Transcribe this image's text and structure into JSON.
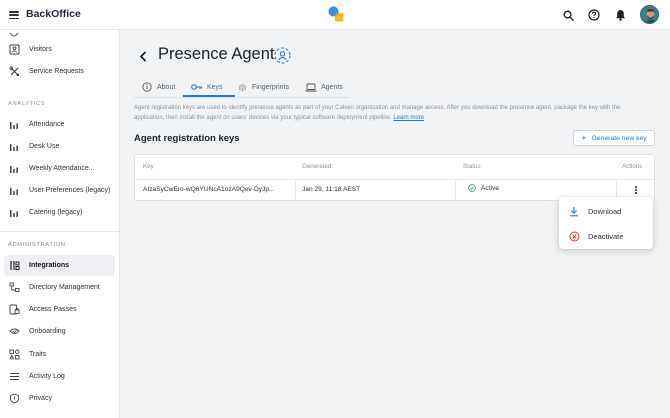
{
  "app": {
    "title": "BackOffice"
  },
  "sidebar": {
    "top_items": [
      {
        "label": "Visitors",
        "icon": "id-card-icon"
      },
      {
        "label": "Service Requests",
        "icon": "tools-icon"
      }
    ],
    "analytics_title": "ANALYTICS",
    "analytics_items": [
      {
        "label": "Attendance"
      },
      {
        "label": "Desk Use"
      },
      {
        "label": "Weekly Attendance..."
      },
      {
        "label": "User Preferences (legacy)"
      },
      {
        "label": "Catering (legacy)"
      }
    ],
    "administration_title": "ADMINISTRATION",
    "administration_items": [
      {
        "label": "Integrations",
        "active": true
      },
      {
        "label": "Directory Management"
      },
      {
        "label": "Access Passes"
      },
      {
        "label": "Onboarding"
      },
      {
        "label": "Traits"
      },
      {
        "label": "Activity Log"
      },
      {
        "label": "Privacy"
      }
    ]
  },
  "page": {
    "title": "Presence Agent",
    "tabs": [
      {
        "label": "About",
        "icon": "info-icon"
      },
      {
        "label": "Keys",
        "icon": "key-icon",
        "active": true
      },
      {
        "label": "Fingerprints",
        "icon": "fingerprint-icon"
      },
      {
        "label": "Agents",
        "icon": "laptop-icon"
      }
    ],
    "description": "Agent registration keys are used to identify presence agents as part of your Calven organization and manage access. After you download the presence agent, package the key with the application, then install the agent on users' devices via your typical software deployment pipeline.",
    "learn_more": "Learn more",
    "section_title": "Agent registration keys",
    "generate_button": "Generate new key"
  },
  "table": {
    "headers": {
      "key": "Key",
      "generated": "Generated",
      "status": "Status",
      "actions": "Actions"
    },
    "rows": [
      {
        "key": "AIzaSyCwEro-wQ6YUNcA1ozA9Qev-DyJp...",
        "generated": "Jan 29, 11:18 AEST",
        "status": "Active"
      }
    ]
  },
  "menu": {
    "download": "Download",
    "deactivate": "Deactivate"
  },
  "colors": {
    "accent": "#2a7ab8",
    "status_active": "#3aa58a",
    "danger": "#d2413a",
    "logo_blue": "#3d8fd9",
    "logo_yellow": "#f3b62c"
  }
}
